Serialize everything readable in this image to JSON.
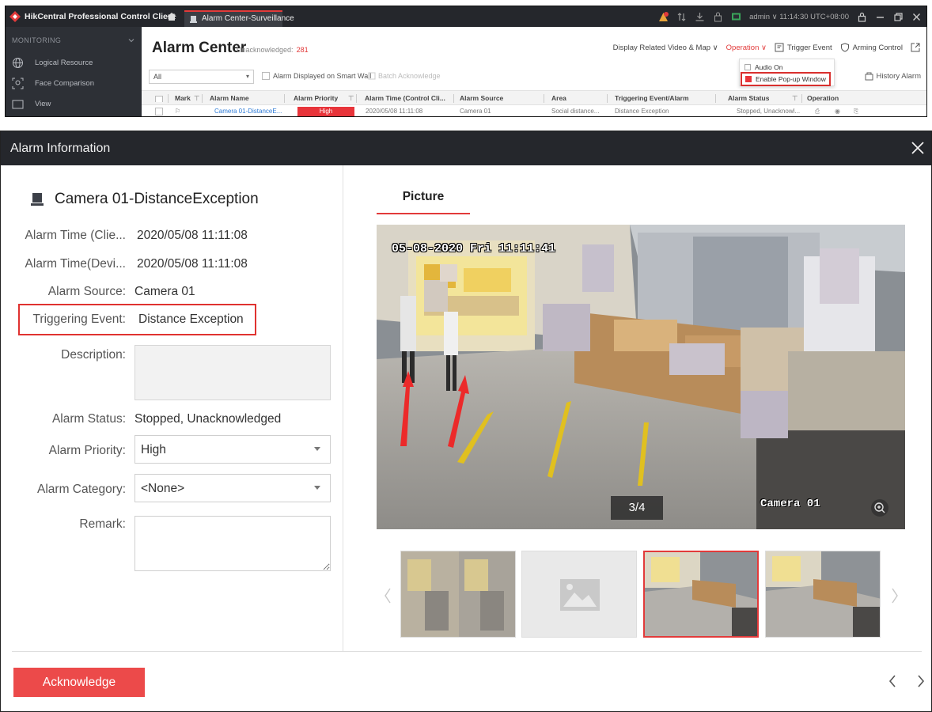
{
  "titlebar": {
    "app_name": "HikCentral Professional Control Client",
    "tab_label": "Alarm Center-Surveillance",
    "user_info": "admin ∨  11:14:30 UTC+08:00"
  },
  "sidebar": {
    "section": "MONITORING",
    "items": [
      {
        "label": "Logical Resource",
        "icon": "globe-icon"
      },
      {
        "label": "Face Comparison",
        "icon": "face-scan-icon"
      },
      {
        "label": "View",
        "icon": "view-icon"
      }
    ]
  },
  "alarm_center": {
    "title": "Alarm Center",
    "unack_label": "Unacknowledged:",
    "unack_count": "281",
    "tools": {
      "display_related": "Display Related Video & Map ∨",
      "operation": "Operation ∨",
      "trigger_event": "Trigger Event",
      "arming_control": "Arming Control"
    },
    "filter_value": "All",
    "smart_wall_label": "Alarm Displayed on Smart Wall",
    "batch_ack_label": "Batch Acknowledge",
    "history_label": "History Alarm",
    "operation_menu": {
      "audio_on": "Audio On",
      "enable_popup": "Enable Pop-up Window"
    },
    "columns": [
      "Mark",
      "Alarm Name",
      "Alarm Priority",
      "Alarm Time (Control Cli...",
      "Alarm Source",
      "Area",
      "Triggering Event/Alarm",
      "Alarm Status",
      "Operation"
    ],
    "row": {
      "alarm_name": "Camera 01-DistanceE...",
      "priority": "High",
      "time": "2020/05/08 11:11:08",
      "source": "Camera 01",
      "area": "Social distance...",
      "event": "Distance Exception",
      "status": "Stopped, Unacknowl..."
    }
  },
  "dialog": {
    "title": "Alarm Information",
    "camera_title": "Camera 01-DistanceException",
    "fields": {
      "time_client_label": "Alarm Time (Clie...",
      "time_client_value": "2020/05/08 11:11:08",
      "time_device_label": "Alarm Time(Devi...",
      "time_device_value": "2020/05/08 11:11:08",
      "source_label": "Alarm Source:",
      "source_value": "Camera 01",
      "event_label": "Triggering Event:",
      "event_value": "Distance Exception",
      "description_label": "Description:",
      "status_label": "Alarm Status:",
      "status_value": "Stopped, Unacknowledged",
      "priority_label": "Alarm Priority:",
      "priority_value": "High",
      "category_label": "Alarm Category:",
      "category_value": "<None>",
      "remark_label": "Remark:"
    },
    "picture_tab": "Picture",
    "osd_date": "05-08-2020 Fri 11:11:41",
    "osd_camera": "Camera 01",
    "counter": "3/4",
    "acknowledge": "Acknowledge"
  },
  "colors": {
    "accent_red": "#e8343a",
    "titlebar_dark": "#25272c",
    "link_blue": "#2d7ad6"
  }
}
